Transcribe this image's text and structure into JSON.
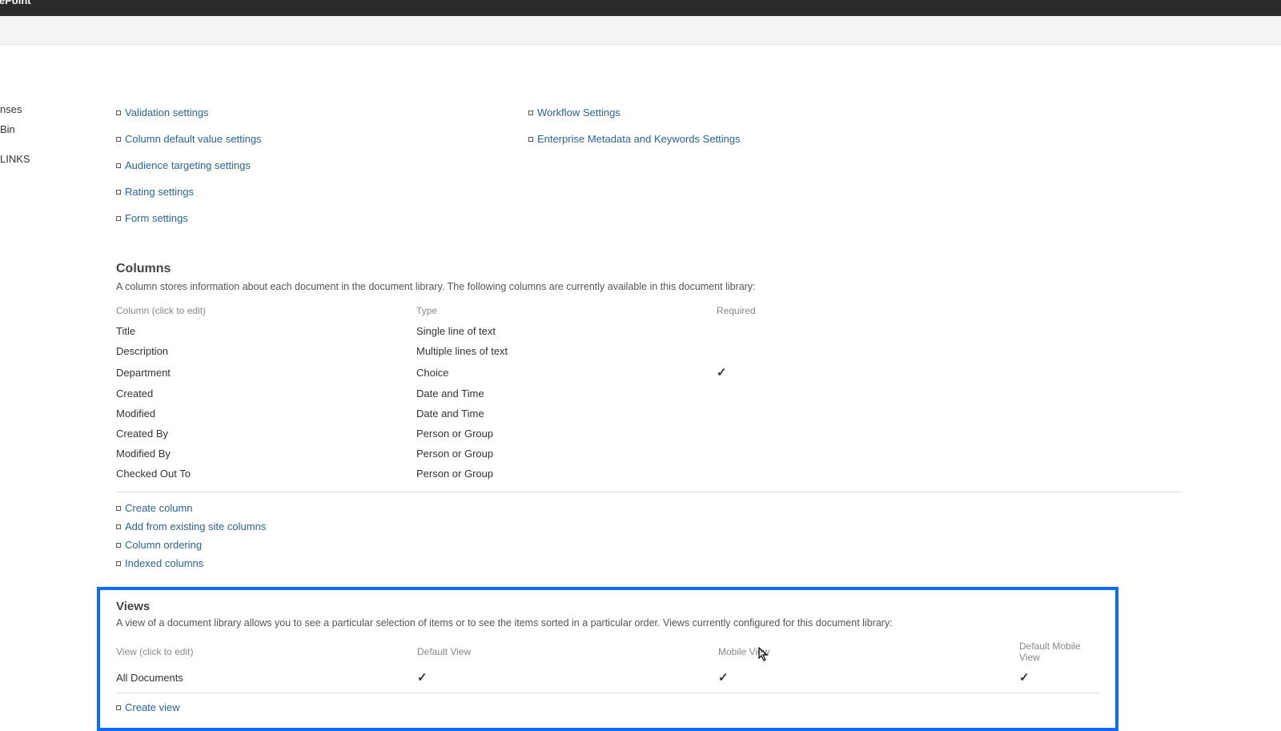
{
  "app": {
    "title": "SharePoint"
  },
  "leftnav": {
    "item1": "nses",
    "item2": "Bin",
    "item3": "LINKS"
  },
  "general_settings": {
    "col1": [
      "Validation settings",
      "Column default value settings",
      "Audience targeting settings",
      "Rating settings",
      "Form settings"
    ],
    "col2": [
      "Workflow Settings",
      "Enterprise Metadata and Keywords Settings"
    ]
  },
  "columns": {
    "title": "Columns",
    "desc": "A column stores information about each document in the document library. The following columns are currently available in this document library:",
    "headers": {
      "c1": "Column (click to edit)",
      "c2": "Type",
      "c3": "Required"
    },
    "rows": [
      {
        "name": "Title",
        "type": "Single line of text",
        "required": false
      },
      {
        "name": "Description",
        "type": "Multiple lines of text",
        "required": false
      },
      {
        "name": "Department",
        "type": "Choice",
        "required": true
      },
      {
        "name": "Created",
        "type": "Date and Time",
        "required": false
      },
      {
        "name": "Modified",
        "type": "Date and Time",
        "required": false
      },
      {
        "name": "Created By",
        "type": "Person or Group",
        "required": false
      },
      {
        "name": "Modified By",
        "type": "Person or Group",
        "required": false
      },
      {
        "name": "Checked Out To",
        "type": "Person or Group",
        "required": false
      }
    ],
    "actions": [
      "Create column",
      "Add from existing site columns",
      "Column ordering",
      "Indexed columns"
    ]
  },
  "views": {
    "title": "Views",
    "desc": "A view of a document library allows you to see a particular selection of items or to see the items sorted in a particular order. Views currently configured for this document library:",
    "headers": {
      "c1": "View (click to edit)",
      "c2": "Default View",
      "c3": "Mobile View",
      "c4": "Default Mobile View"
    },
    "rows": [
      {
        "name": "All Documents",
        "default": true,
        "mobile": true,
        "default_mobile": true
      }
    ],
    "create_link": "Create view"
  }
}
